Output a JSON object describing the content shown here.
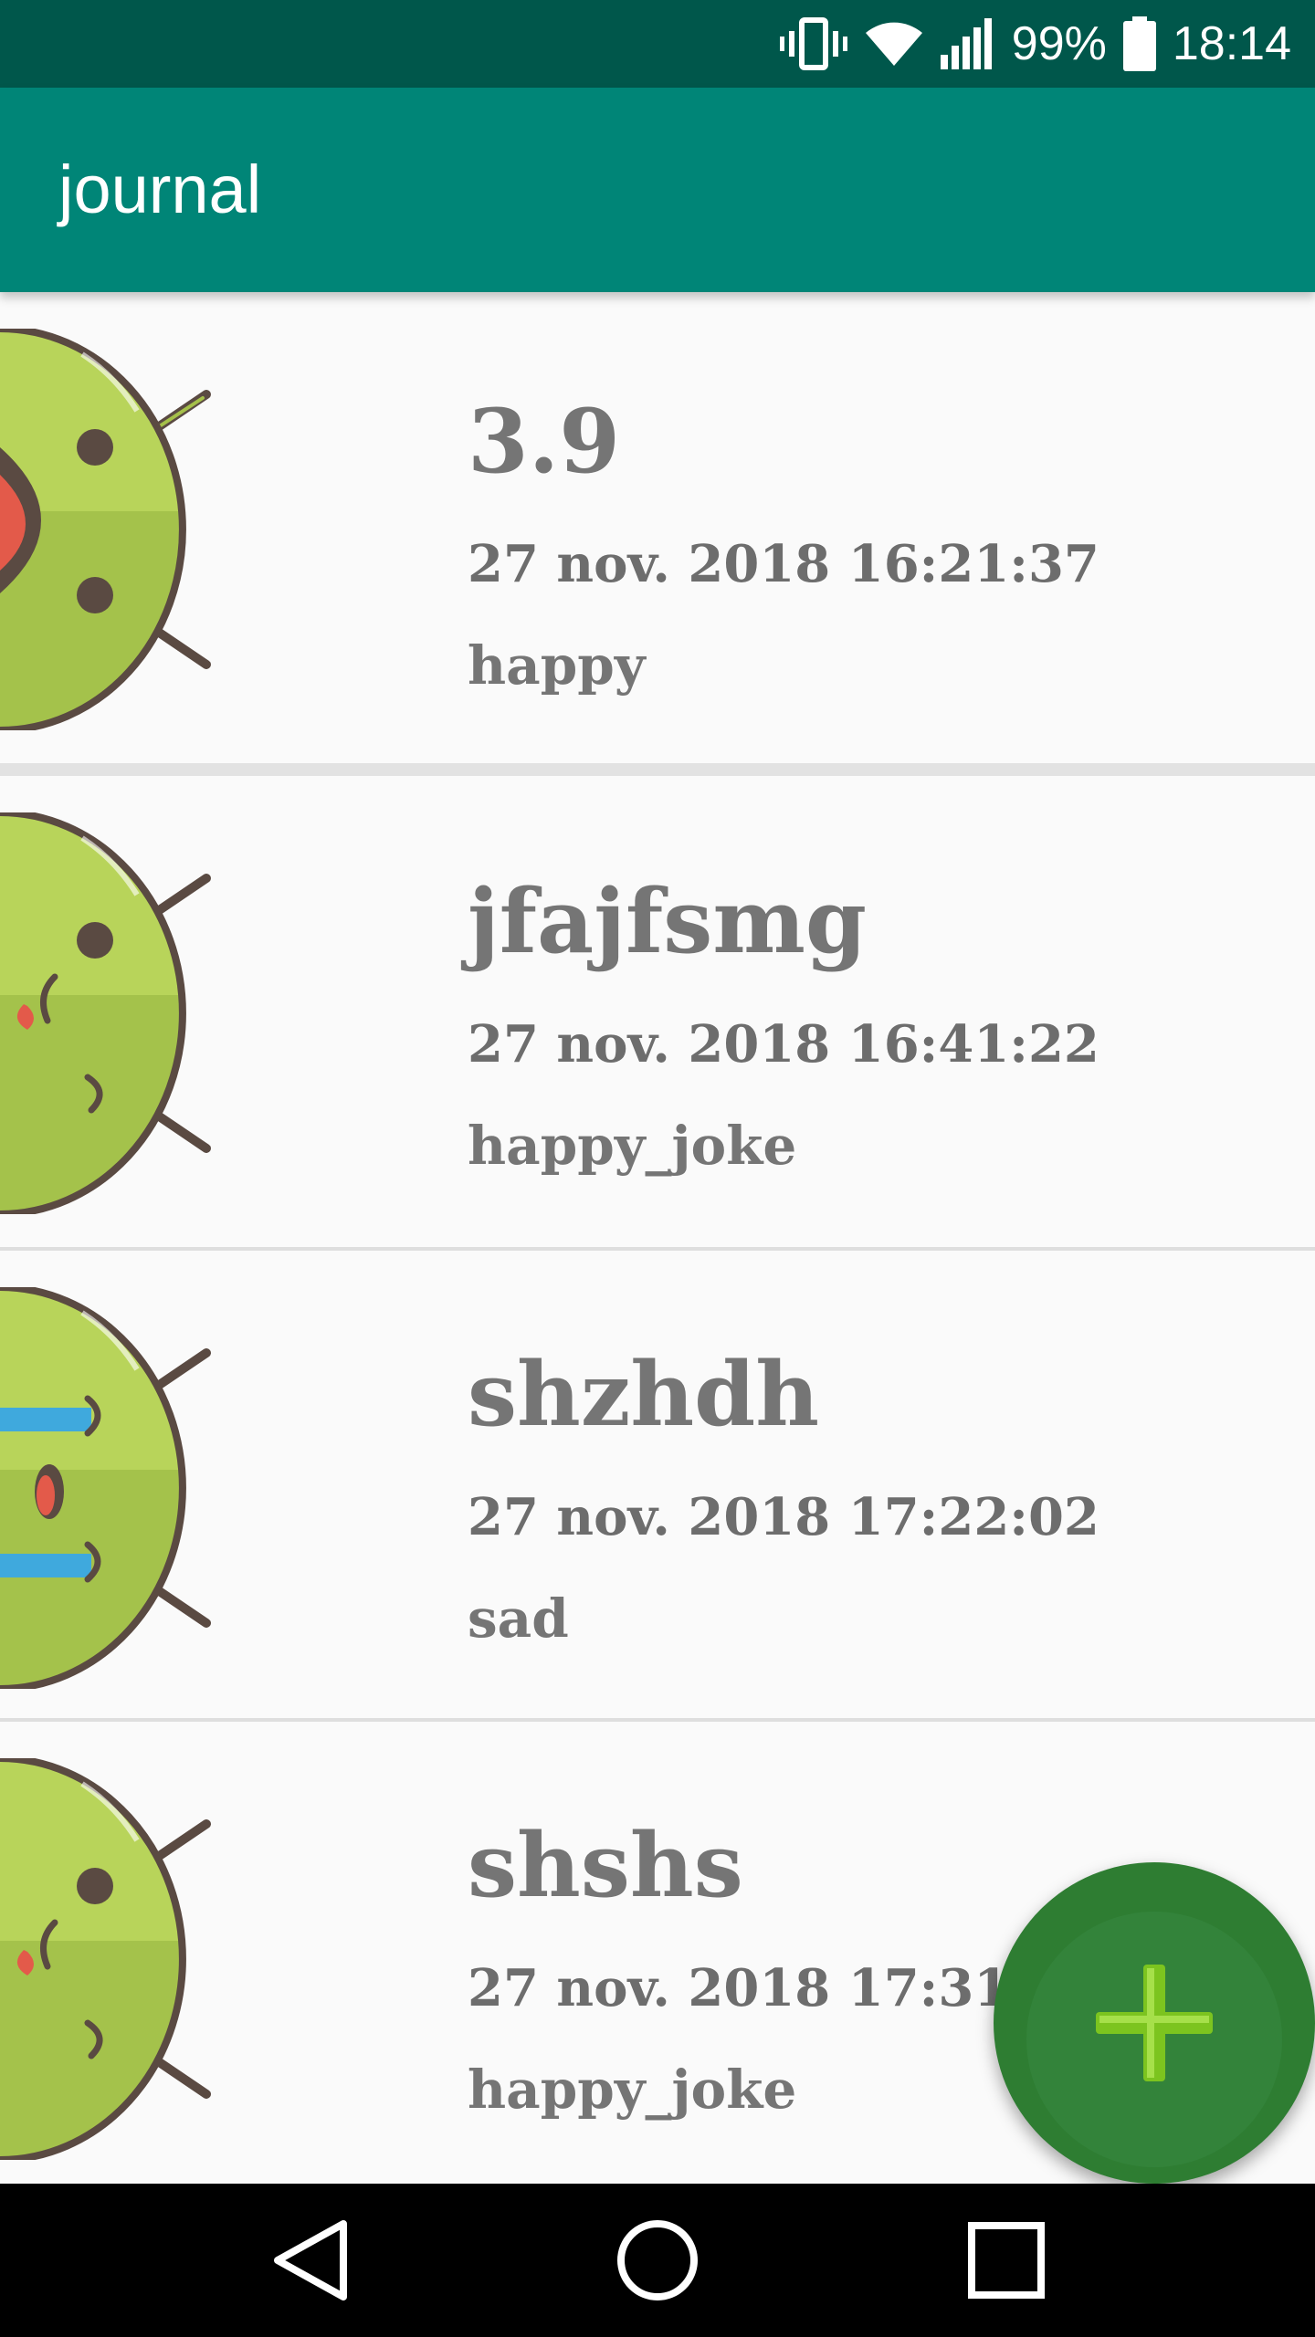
{
  "status_bar": {
    "battery_percent": "99%",
    "time": "18:14",
    "icons": [
      "vibrate-icon",
      "wifi-icon",
      "signal-icon",
      "battery-icon"
    ]
  },
  "app_bar": {
    "title": "journal",
    "color": "#008577"
  },
  "entries": [
    {
      "title": "3.9",
      "date": "27 nov. 2018 16:21:37",
      "mood": "happy",
      "avatar": "happy-android-icon"
    },
    {
      "title": "jfajfsmg",
      "date": "27 nov. 2018 16:41:22",
      "mood": "happy_joke",
      "avatar": "happy-joke-android-icon"
    },
    {
      "title": "shzhdh",
      "date": "27 nov. 2018 17:22:02",
      "mood": "sad",
      "avatar": "sad-android-icon"
    },
    {
      "title": "shshs",
      "date": "27 nov. 2018 17:31:29",
      "mood": "happy_joke",
      "avatar": "happy-joke-android-icon"
    }
  ],
  "fab": {
    "icon": "plus-icon",
    "color": "#2e7d32"
  },
  "nav_bar": {
    "icons": [
      "back-icon",
      "home-icon",
      "recents-icon"
    ]
  }
}
